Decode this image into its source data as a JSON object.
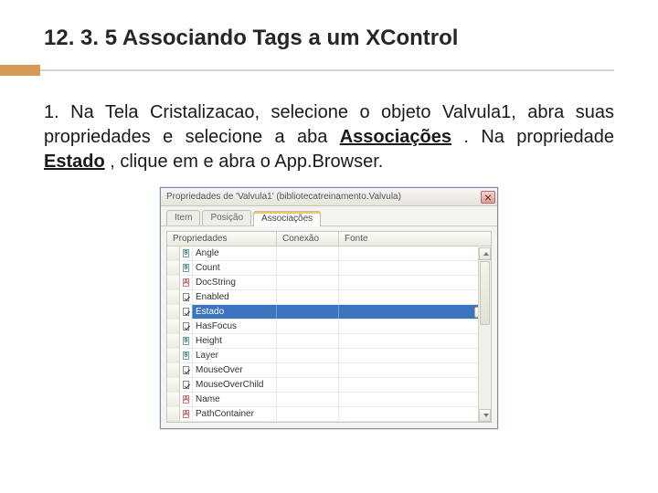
{
  "heading": "12. 3. 5 Associando Tags a um XControl",
  "paragraph": {
    "prefix": "1. Na Tela Cristalizacao, selecione o objeto Valvula1, abra suas propriedades e selecione a aba ",
    "assoc": "Associações",
    "mid": ". Na propriedade ",
    "estado": "Estado",
    "suffix": ", clique em e abra o App.Browser."
  },
  "dialog": {
    "title": "Propriedades de 'Valvula1' (bibliotecatreinamento.Valvula)",
    "tabs": [
      {
        "label": "Item",
        "active": false
      },
      {
        "label": "Posição",
        "active": false
      },
      {
        "label": "Associações",
        "active": true
      }
    ],
    "columns": {
      "prop": "Propriedades",
      "conn": "Conexão",
      "font": "Fonte"
    },
    "rows": [
      {
        "type": "9",
        "name": "Angle"
      },
      {
        "type": "9",
        "name": "Count"
      },
      {
        "type": "A",
        "name": "DocString"
      },
      {
        "type": "chk",
        "name": "Enabled"
      },
      {
        "type": "chk",
        "name": "Estado",
        "selected": true
      },
      {
        "type": "chk",
        "name": "HasFocus"
      },
      {
        "type": "9",
        "name": "Height"
      },
      {
        "type": "9",
        "name": "Layer"
      },
      {
        "type": "chk",
        "name": "MouseOver"
      },
      {
        "type": "chk",
        "name": "MouseOverChild"
      },
      {
        "type": "A",
        "name": "Name"
      },
      {
        "type": "A",
        "name": "PathContainer"
      }
    ]
  }
}
